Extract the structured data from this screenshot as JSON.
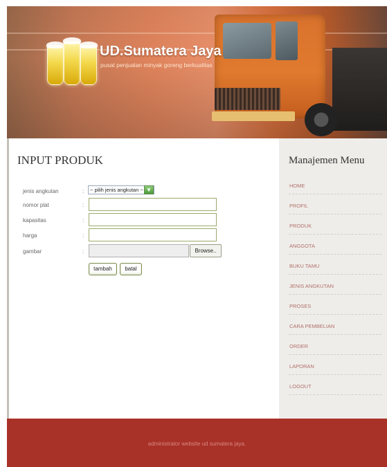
{
  "header": {
    "brand_name": "UD.Sumatera Jaya",
    "tagline": "pusat penjualan minyak goreng berkualitas"
  },
  "main": {
    "title": "INPUT PRODUK",
    "form": {
      "jenis_label": "jenis angkutan",
      "jenis_selected": "~ pilih jenis angkutan ~",
      "nomor_label": "nomor plat",
      "nomor_value": "",
      "kapasitas_label": "kapasitas",
      "kapasitas_value": "",
      "harga_label": "harga",
      "harga_value": "",
      "gambar_label": "gambar",
      "gambar_value": "",
      "browse_label": "Browse..",
      "colon": ":",
      "submit_label": "tambah",
      "cancel_label": "batal"
    }
  },
  "sidebar": {
    "title": "Manajemen Menu",
    "items": [
      {
        "label": "HOME"
      },
      {
        "label": "PROFIL"
      },
      {
        "label": "PRODUK"
      },
      {
        "label": "ANGGOTA"
      },
      {
        "label": "BUKU TAMU"
      },
      {
        "label": "JENIS ANGKUTAN"
      },
      {
        "label": "PROSES"
      },
      {
        "label": "CARA PEMBELIAN"
      },
      {
        "label": "ORDER"
      },
      {
        "label": "LAPORAN"
      },
      {
        "label": "LOGOUT"
      }
    ]
  },
  "footer": {
    "text": "administrator website ud sumatera jaya."
  },
  "colors": {
    "footer_bg": "#a83128",
    "sidebar_bg": "#efedea",
    "menu_link": "#b0706a"
  },
  "icons": {
    "select_arrow": "chevron-down-icon",
    "logo": "oil-glasses-logo-icon"
  }
}
